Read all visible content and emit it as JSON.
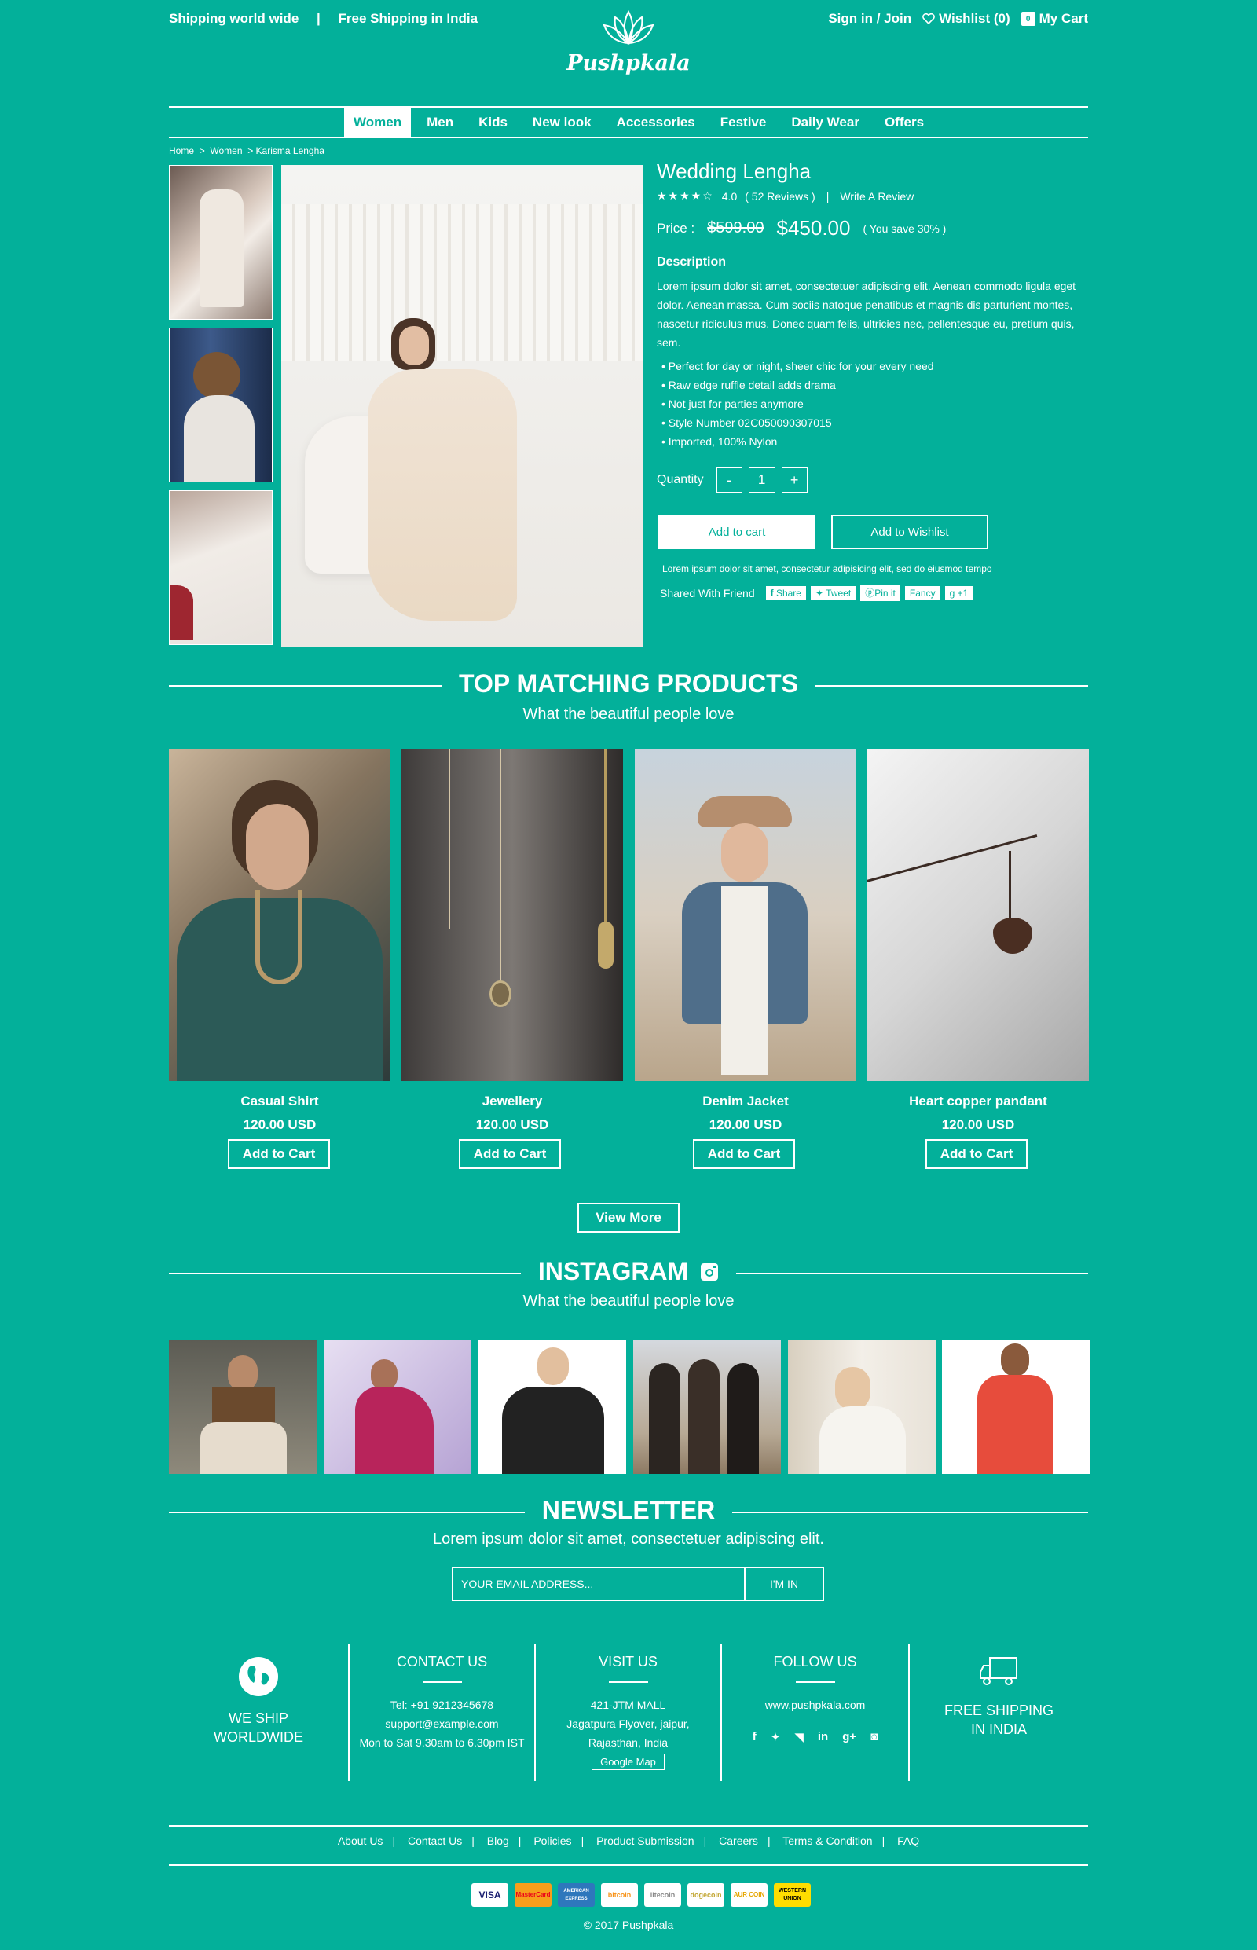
{
  "topbar": {
    "shipping_world": "Shipping world wide",
    "divider": "|",
    "free_shipping": "Free Shipping in India",
    "sign_in": "Sign in / Join",
    "wishlist": "Wishlist (0)",
    "cart": "My Cart",
    "cart_count": "0"
  },
  "logo": {
    "name": "Pushpkala"
  },
  "nav": {
    "items": [
      "Women",
      "Men",
      "Kids",
      "New look",
      "Accessories",
      "Festive",
      "Daily Wear",
      "Offers"
    ],
    "active": "Women"
  },
  "breadcrumb": {
    "home": "Home",
    "women": "Women",
    "product": "Karisma Lengha",
    "sep": ">"
  },
  "product": {
    "title": "Wedding Lengha",
    "rating_value": 4.0,
    "rating_text": "4.0",
    "reviews": "( 52 Reviews )",
    "write_review": "Write A Review",
    "price_label": "Price :",
    "old_price": "$599.00",
    "new_price": "$450.00",
    "save": "( You save 30% )",
    "description_heading": "Description",
    "description": "Lorem ipsum dolor sit amet, consectetuer adipiscing elit. Aenean commodo ligula eget dolor. Aenean massa. Cum sociis natoque penatibus et magnis dis parturient montes, nascetur ridiculus mus. Donec quam felis, ultricies nec, pellentesque eu, pretium quis, sem.",
    "features": [
      "Perfect for day or night, sheer chic for your every need",
      "Raw edge ruffle detail adds drama",
      "Not just for parties anymore",
      "Style Number 02C050090307015",
      "Imported, 100% Nylon"
    ],
    "quantity_label": "Quantity",
    "quantity": "1",
    "minus": "-",
    "plus": "+",
    "add_to_cart": "Add to cart",
    "add_to_wishlist": "Add to Wishlist",
    "note": "Lorem ipsum dolor sit amet, consectetur adipisicing elit, sed do eiusmod tempo",
    "shared_label": "Shared With Friend",
    "share_buttons": [
      "Share",
      "Tweet",
      "Pin it",
      "Fancy",
      "+1"
    ]
  },
  "matching": {
    "title": "TOP MATCHING PRODUCTS",
    "subtitle": "What the beautiful people love",
    "products": [
      {
        "name": "Casual Shirt",
        "price": "120.00 USD",
        "button": "Add to Cart"
      },
      {
        "name": "Jewellery",
        "price": "120.00 USD",
        "button": "Add to Cart"
      },
      {
        "name": "Denim Jacket",
        "price": "120.00 USD",
        "button": "Add to Cart"
      },
      {
        "name": "Heart copper pandant",
        "price": "120.00 USD",
        "button": "Add to Cart"
      }
    ],
    "view_more": "View More"
  },
  "instagram": {
    "title": "INSTAGRAM",
    "subtitle": "What the beautiful people love"
  },
  "newsletter": {
    "title": "NEWSLETTER",
    "subtitle": "Lorem ipsum dolor sit amet, consectetuer adipiscing elit.",
    "placeholder": "YOUR EMAIL ADDRESS...",
    "button": "I'M IN"
  },
  "footer": {
    "ship_worldwide": "WE SHIP WORLDWIDE",
    "contact_title": "CONTACT US",
    "contact_tel": "Tel: +91 9212345678",
    "contact_email": "support@example.com",
    "contact_hours": "Mon to Sat 9.30am to 6.30pm IST",
    "visit_title": "VISIT US",
    "visit_line1": "421-JTM MALL",
    "visit_line2": "Jagatpura Flyover, jaipur,",
    "visit_line3": "Rajasthan, India",
    "google_map": "Google Map",
    "follow_title": "FOLLOW US",
    "follow_url": "www.pushpkala.com",
    "free_shipping": "FREE SHIPPING IN INDIA",
    "links": [
      "About Us",
      "Contact Us",
      "Blog",
      "Policies",
      "Product Submission",
      "Careers",
      "Terms & Condition",
      "FAQ"
    ],
    "payments": [
      "VISA",
      "MasterCard",
      "AMERICAN EXPRESS",
      "bitcoin",
      "litecoin",
      "dogecoin",
      "AUR COIN",
      "WESTERN UNION"
    ],
    "copyright": "© 2017  Pushpkala"
  },
  "colors": {
    "background": "#03b09a",
    "text": "#ffffff"
  }
}
